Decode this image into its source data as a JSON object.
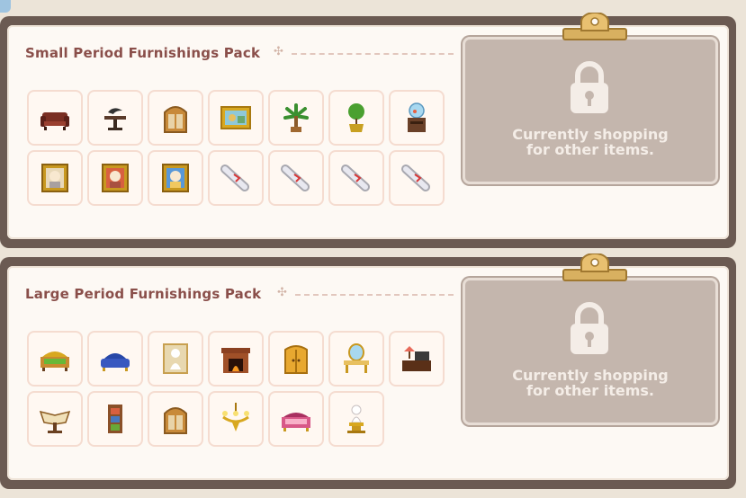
{
  "packs": [
    {
      "title": "Small Period Furnishings Pack",
      "locked_message_line1": "Currently shopping",
      "locked_message_line2": "for other items.",
      "items": [
        "sofa-icon",
        "bird-statue-table-icon",
        "wooden-window-icon",
        "framed-painting-icon",
        "palm-plant-icon",
        "potted-shrub-icon",
        "fishbowl-cabinet-icon",
        "portrait-icon",
        "portrait-icon",
        "portrait-icon",
        "recipe-scroll-icon",
        "recipe-scroll-icon",
        "recipe-scroll-icon",
        "recipe-scroll-icon"
      ]
    },
    {
      "title": "Large Period Furnishings Pack",
      "locked_message_line1": "Currently shopping",
      "locked_message_line2": "for other items.",
      "items": [
        "bed-icon",
        "blue-sofa-icon",
        "statue-frame-icon",
        "fireplace-icon",
        "wardrobe-icon",
        "vanity-mirror-icon",
        "desk-lamp-icon",
        "book-lectern-icon",
        "bookshelf-icon",
        "wooden-window-icon",
        "chandelier-icon",
        "pink-bed-icon",
        "statue-pedestal-icon"
      ]
    }
  ],
  "colors": {
    "panel_frame": "#6b5a52",
    "title": "#8a4f4a",
    "lock_box": "#c4b6ad",
    "slot_border": "#f5dcd0"
  }
}
